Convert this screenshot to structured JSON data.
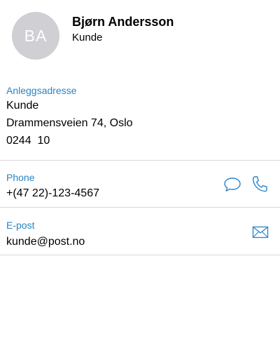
{
  "contact": {
    "initials": "BA",
    "name": "Bjørn Andersson",
    "role": "Kunde"
  },
  "address": {
    "label": "Anleggsadresse",
    "line1": "Kunde",
    "line2": "Drammensveien 74, Oslo",
    "line3": "0244  10"
  },
  "phone": {
    "label": "Phone",
    "value": "+(47 22)-123-4567",
    "message_icon": "chat-bubble-icon",
    "call_icon": "phone-icon"
  },
  "email": {
    "label": "E-post",
    "value": "kunde@post.no",
    "mail_icon": "envelope-icon"
  },
  "colors": {
    "accent": "#2a84c8",
    "avatar_bg": "#cfcfd4",
    "divider": "#d9d9dd"
  }
}
